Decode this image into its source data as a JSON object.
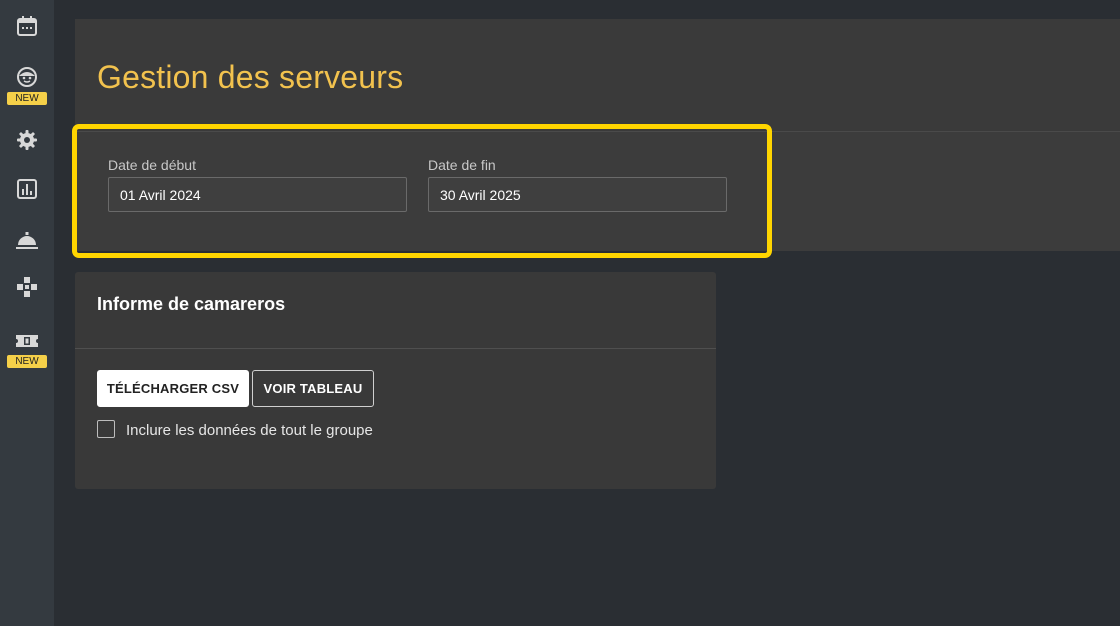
{
  "page": {
    "title": "Gestion des serveurs"
  },
  "sidebar": {
    "items": [
      {
        "icon": "calendar-icon",
        "badge": ""
      },
      {
        "icon": "face-icon",
        "badge": "NEW"
      },
      {
        "icon": "gear-icon",
        "badge": ""
      },
      {
        "icon": "bar-chart-icon",
        "badge": ""
      },
      {
        "icon": "service-bell-icon",
        "badge": ""
      },
      {
        "icon": "puzzle-icon",
        "badge": ""
      },
      {
        "icon": "ticket-icon",
        "badge": "NEW"
      }
    ]
  },
  "filters": {
    "start_label": "Date de début",
    "start_value": "01 Avril 2024",
    "end_label": "Date de fin",
    "end_value": "30 Avril 2025"
  },
  "report": {
    "title": "Informe de camareros",
    "download_csv_label": "TÉLÉCHARGER CSV",
    "view_table_label": "VOIR TABLEAU",
    "include_group_label": "Inclure les données de tout le groupe",
    "include_group_checked": false
  },
  "colors": {
    "title_accent": "#f2c24e",
    "highlight": "#ffd500",
    "badge": "#f5d049",
    "background": "#2a2e33"
  }
}
